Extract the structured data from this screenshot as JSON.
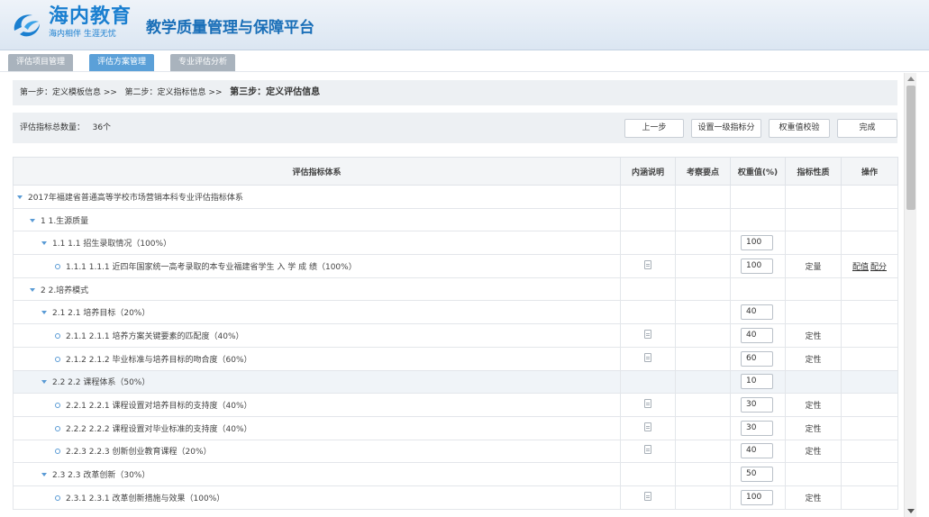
{
  "brand": {
    "name": "海内教育",
    "slogan": "海内相伴 生涯无忧",
    "platform_title": "教学质量管理与保障平台"
  },
  "tabs": [
    {
      "label": "评估项目管理"
    },
    {
      "label": "评估方案管理"
    },
    {
      "label": "专业评估分析"
    }
  ],
  "steps": {
    "step1": "第一步：定义模板信息 >>",
    "step2": "第二步：定义指标信息 >>",
    "step3": "第三步：定义评估信息"
  },
  "summary": {
    "count_label": "评估指标总数量：",
    "count_value": "36个"
  },
  "buttons": {
    "prev": "上一步",
    "set_score": "设置一级指标分",
    "weight_check": "权重值校验",
    "finish": "完成"
  },
  "table": {
    "headers": [
      "评估指标体系",
      "内涵说明",
      "考察要点",
      "权重值(%)",
      "指标性质",
      "操作"
    ],
    "ops": {
      "config_value": "配值",
      "config_score": "配分"
    },
    "rows": [
      {
        "level": 0,
        "name": "2017年福建省普通高等学校市场营销本科专业评估指标体系",
        "weight": "",
        "nature": "",
        "doc": false,
        "ops": false
      },
      {
        "level": 1,
        "name": "1 1.生源质量",
        "weight": "",
        "nature": "",
        "doc": false,
        "ops": false
      },
      {
        "level": 2,
        "name": "1.1 1.1 招生录取情况（100%）",
        "weight": "100",
        "nature": "",
        "doc": false,
        "ops": false
      },
      {
        "level": 3,
        "name": "1.1.1 1.1.1 近四年国家统一高考录取的本专业福建省学生 入 学 成 绩（100%）",
        "weight": "100",
        "nature": "定量",
        "doc": true,
        "ops": true
      },
      {
        "level": 1,
        "name": "2 2.培养模式",
        "weight": "",
        "nature": "",
        "doc": false,
        "ops": false
      },
      {
        "level": 2,
        "name": "2.1 2.1 培养目标（20%）",
        "weight": "40",
        "nature": "",
        "doc": false,
        "ops": false
      },
      {
        "level": 3,
        "name": "2.1.1 2.1.1 培养方案关键要素的匹配度（40%）",
        "weight": "40",
        "nature": "定性",
        "doc": true,
        "ops": false
      },
      {
        "level": 3,
        "name": "2.1.2 2.1.2 毕业标准与培养目标的吻合度（60%）",
        "weight": "60",
        "nature": "定性",
        "doc": true,
        "ops": false
      },
      {
        "level": 2,
        "name": "2.2 2.2 课程体系（50%）",
        "weight": "10",
        "nature": "",
        "doc": false,
        "ops": false,
        "highlight": true
      },
      {
        "level": 3,
        "name": "2.2.1 2.2.1 课程设置对培养目标的支持度（40%）",
        "weight": "30",
        "nature": "定性",
        "doc": true,
        "ops": false
      },
      {
        "level": 3,
        "name": "2.2.2 2.2.2 课程设置对毕业标准的支持度（40%）",
        "weight": "30",
        "nature": "定性",
        "doc": true,
        "ops": false
      },
      {
        "level": 3,
        "name": "2.2.3 2.2.3 创新创业教育课程（20%）",
        "weight": "40",
        "nature": "定性",
        "doc": true,
        "ops": false
      },
      {
        "level": 2,
        "name": "2.3 2.3 改革创新（30%）",
        "weight": "50",
        "nature": "",
        "doc": false,
        "ops": false
      },
      {
        "level": 3,
        "name": "2.3.1 2.3.1 改革创新措施与效果（100%）",
        "weight": "100",
        "nature": "定性",
        "doc": true,
        "ops": false
      }
    ]
  },
  "colors": {
    "accent": "#1a7fd0",
    "tab_active": "#5ba0d8",
    "tab_inactive": "#a9b3bd",
    "tree_icon": "#5a9bd5"
  }
}
